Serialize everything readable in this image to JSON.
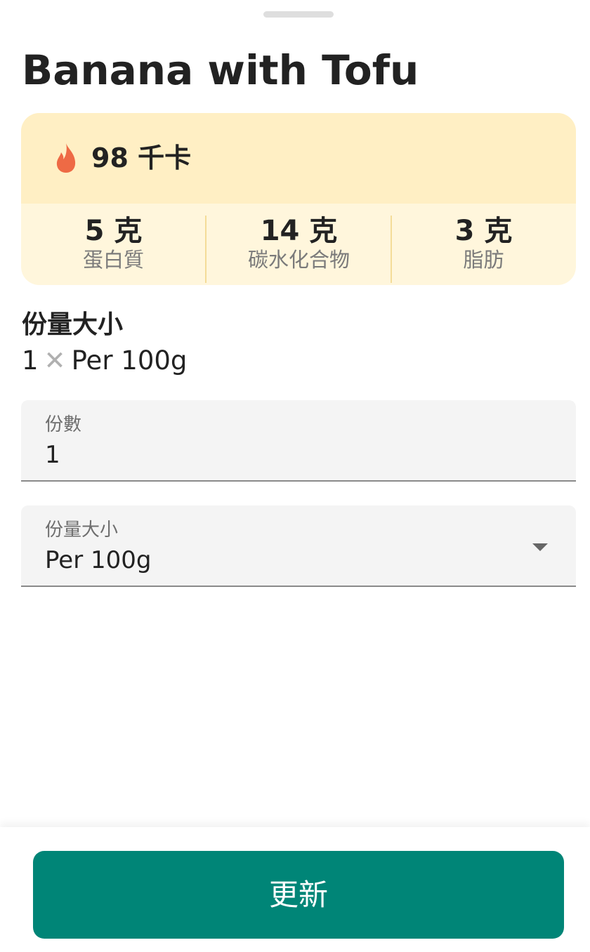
{
  "food": {
    "title": "Banana with Tofu"
  },
  "nutrition": {
    "calories": "98 千卡",
    "macros": [
      {
        "amount": "5 克",
        "label": "蛋白質"
      },
      {
        "amount": "14 克",
        "label": "碳水化合物"
      },
      {
        "amount": "3 克",
        "label": "脂肪"
      }
    ]
  },
  "serving": {
    "heading": "份量大小",
    "count": "1",
    "times": "✕",
    "size": "Per 100g"
  },
  "servings_field": {
    "label": "份數",
    "value": "1"
  },
  "size_field": {
    "label": "份量大小",
    "value": "Per 100g"
  },
  "actions": {
    "update_label": "更新"
  },
  "colors": {
    "accent": "#008577",
    "flame": "#EE6A45",
    "calorie_bg": "#FFEFC4",
    "macro_bg": "#FFF6DC"
  },
  "icons": {
    "calories": "flame-icon",
    "size_dropdown": "dropdown-arrow-icon"
  }
}
